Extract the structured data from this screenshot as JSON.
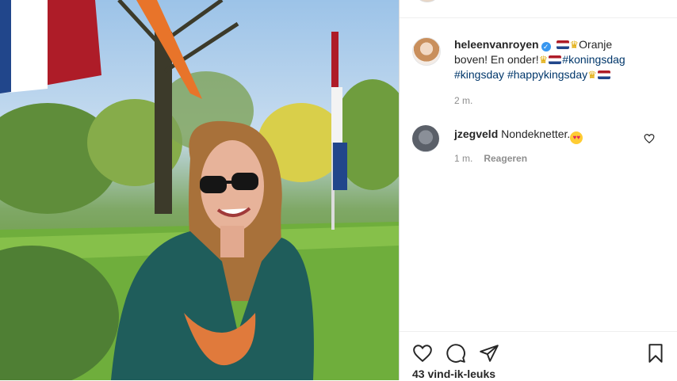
{
  "post": {
    "author": "heleenvanroyen",
    "verified": true,
    "caption_text_1": "Oranje",
    "caption_text_2": "boven! En onder!",
    "hashtag_1": "#koningsdag",
    "hashtag_2": "#kingsday",
    "hashtag_3": "#happykingsday",
    "caption_time": "2 m.",
    "likes": "43 vind-ik-leuks"
  },
  "comments": [
    {
      "user": "jzegveld",
      "text": "Nondeknetter.",
      "time": "1 m.",
      "reply_label": "Reageren"
    }
  ],
  "icons": {
    "verified": "verified-badge-icon",
    "like": "heart-icon",
    "comment": "comment-bubble-icon",
    "share": "paper-plane-icon",
    "save": "bookmark-icon"
  },
  "colors": {
    "link": "#00376b",
    "muted": "#8e8e8e",
    "verified": "#3897f0",
    "text": "#262626"
  }
}
